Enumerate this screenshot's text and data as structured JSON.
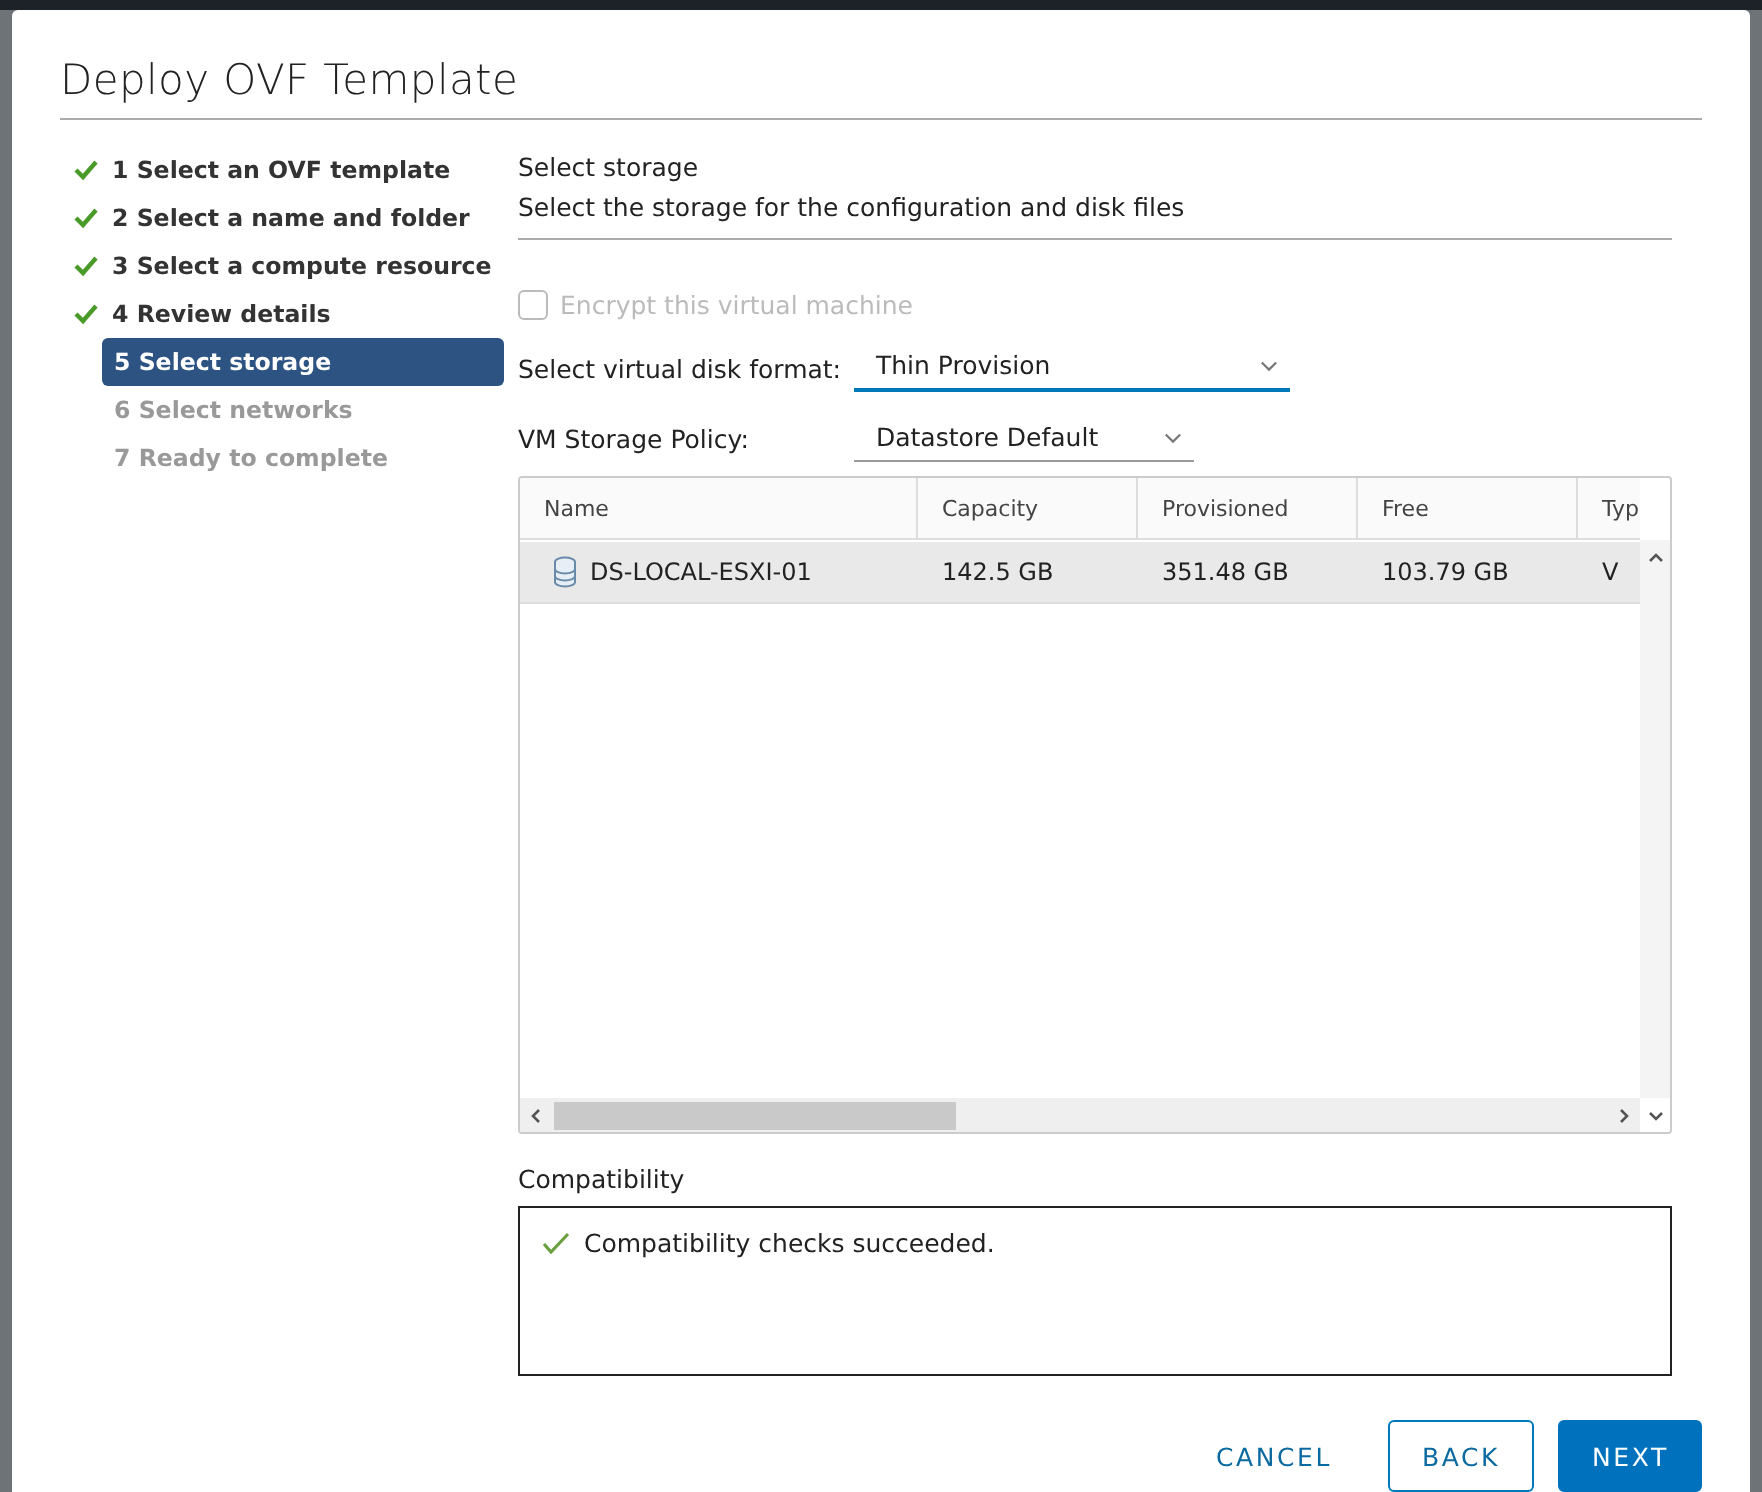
{
  "dialog": {
    "title": "Deploy OVF Template"
  },
  "steps": [
    {
      "label": "1 Select an OVF template",
      "completed": true,
      "selected": false
    },
    {
      "label": "2 Select a name and folder",
      "completed": true,
      "selected": false
    },
    {
      "label": "3 Select a compute resource",
      "completed": true,
      "selected": false
    },
    {
      "label": "4 Review details",
      "completed": true,
      "selected": false
    },
    {
      "label": "5 Select storage",
      "completed": false,
      "selected": true
    },
    {
      "label": "6 Select networks",
      "completed": false,
      "selected": false
    },
    {
      "label": "7 Ready to complete",
      "completed": false,
      "selected": false
    }
  ],
  "page": {
    "heading": "Select storage",
    "description": "Select the storage for the configuration and disk files"
  },
  "encrypt": {
    "label": "Encrypt this virtual machine",
    "checked": false,
    "disabled": true
  },
  "disk_format": {
    "label": "Select virtual disk format:",
    "value": "Thin Provision",
    "focused": true
  },
  "storage_policy": {
    "label": "VM Storage Policy:",
    "value": "Datastore Default",
    "focused": false
  },
  "table": {
    "columns": [
      "Name",
      "Capacity",
      "Provisioned",
      "Free",
      "Typ"
    ],
    "rows": [
      {
        "cells": [
          "DS-LOCAL-ESXI-01",
          "142.5 GB",
          "351.48 GB",
          "103.79 GB",
          "V"
        ],
        "selected": true
      }
    ]
  },
  "compatibility": {
    "label": "Compatibility",
    "message": "Compatibility checks succeeded.",
    "ok": true
  },
  "buttons": [
    {
      "label": "CANCEL",
      "kind": "flat"
    },
    {
      "label": "BACK",
      "kind": "outline"
    },
    {
      "label": "NEXT",
      "kind": "primary"
    }
  ]
}
